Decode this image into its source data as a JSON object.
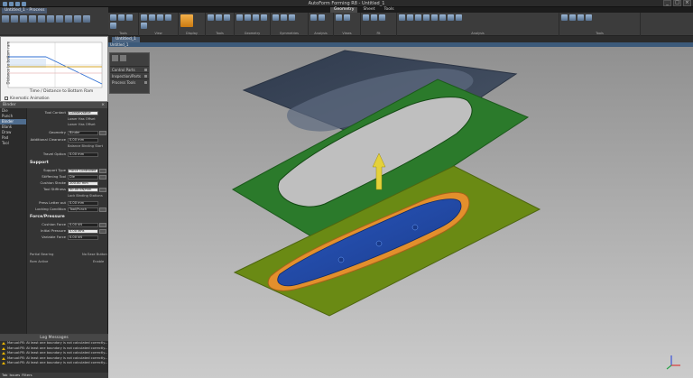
{
  "app": {
    "title": "AutoForm Forming R8 - Untitled_1",
    "ribbon_tabs": [
      "Geometry",
      "Sheet",
      "Tools"
    ],
    "active_ribbon_tab": "Geometry",
    "window_controls": [
      "_",
      "□",
      "×"
    ]
  },
  "left_header": {
    "doc_tab": "Untitled_1 - Process",
    "modes": [
      "Def",
      "Setup",
      "Blanks",
      "Stack",
      "Draw",
      "Trim",
      "Process",
      "Cam"
    ]
  },
  "ribbon_groups": [
    {
      "label": "Tools"
    },
    {
      "label": "View"
    },
    {
      "label": "Display"
    },
    {
      "label": "Tools"
    },
    {
      "label": "Geometry"
    },
    {
      "label": "Symmetries"
    },
    {
      "label": "Analysis"
    },
    {
      "label": "Views"
    },
    {
      "label": "Fit"
    },
    {
      "label": "Analysis"
    },
    {
      "label": "Tools"
    }
  ],
  "plot": {
    "xlabel": "Time / Distance to Bottom Ram",
    "ylabel": "Distance to bottom ram",
    "kinematic_label": "Kinematic Animation"
  },
  "properties": {
    "header": "Binder",
    "tree_items": [
      "Die",
      "Punch",
      "Binder",
      "Blank",
      "Draw",
      "Pad",
      "Tool"
    ],
    "selected_tree_item": "Binder",
    "rows": [
      {
        "label": "Tool Contact",
        "value": "Conservative"
      },
      {
        "label": "Geometry",
        "value": "Binder"
      },
      {
        "label": "Additional Clearance",
        "value": "0.00 mm"
      },
      {
        "label": "Travel Option",
        "value": "0.00 mm"
      },
      {
        "label": "Support Type",
        "value": "Force Controlled"
      },
      {
        "label": "Stiffening Tool",
        "value": "Die"
      },
      {
        "label": "Cushion Stroke",
        "value": "200.00 mm"
      },
      {
        "label": "Tool Stiffness",
        "value": "50.00 kN/mm"
      },
      {
        "label": "Press Letter out",
        "value": "0.00 mm"
      },
      {
        "label": "Locking Condition",
        "value": "Tool/Punch"
      },
      {
        "label": "Cushion Force",
        "value": "0.00 kN"
      },
      {
        "label": "Initial Pressure",
        "value": "0.00 MPa"
      },
      {
        "label": "Variable Force",
        "value": "0.00 kN"
      }
    ],
    "sections": [
      "Support",
      "Force/Pressure"
    ],
    "options": [
      "Lower Has Offset",
      "Lower Has Offset",
      "Balance Binding Start",
      "Lock Binding Stations",
      "Partial Bearing",
      "Ram Active"
    ],
    "right_notes": [
      "No Ease Button",
      "Enable"
    ]
  },
  "log": {
    "title": "Log Messages",
    "lines": [
      "Manual:P8: At least one boundary is not calculated correctly...",
      "Manual:P8: At least one boundary is not calculated correctly...",
      "Manual:P8: At least one boundary is not calculated correctly...",
      "Manual:P8: At least one boundary is not calculated correctly...",
      "Manual:P8: At least one boundary is not calculated correctly..."
    ],
    "footer": [
      "Tab",
      "Issues",
      "Filters"
    ]
  },
  "viewport": {
    "tab": "Untitled_1",
    "title": "Untitled_1",
    "panel_rows": [
      "Control Parts",
      "Inspection/Parts",
      "Process Tools"
    ],
    "colors": {
      "die": "#3a4558",
      "binder": "#2b7a2b",
      "punch_plate": "#6a8a14",
      "part": "#2f5cb8",
      "flange": "#e38f2c",
      "arrow": "#e4d13a"
    }
  }
}
